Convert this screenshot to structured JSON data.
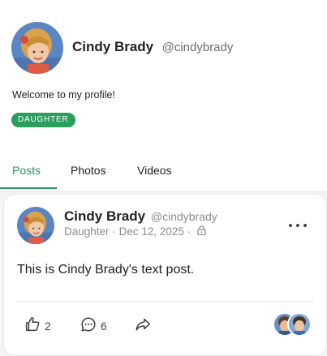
{
  "profile": {
    "display_name": "Cindy Brady",
    "handle": "@cindybrady",
    "bio": "Welcome to my profile!",
    "badge": "DAUGHTER"
  },
  "tabs": [
    {
      "label": "Posts",
      "active": true
    },
    {
      "label": "Photos",
      "active": false
    },
    {
      "label": "Videos",
      "active": false
    }
  ],
  "post": {
    "author_name": "Cindy Brady",
    "author_handle": "@cindybrady",
    "author_role": "Daughter",
    "date": "Dec 12, 2025",
    "visibility_icon": "lock-icon",
    "text": "This is Cindy Brady's text post.",
    "like_count": "2",
    "comment_count": "6"
  },
  "colors": {
    "accent": "#27995a",
    "badge_bg": "#2a9e5c",
    "muted_text": "#8a8a93"
  }
}
